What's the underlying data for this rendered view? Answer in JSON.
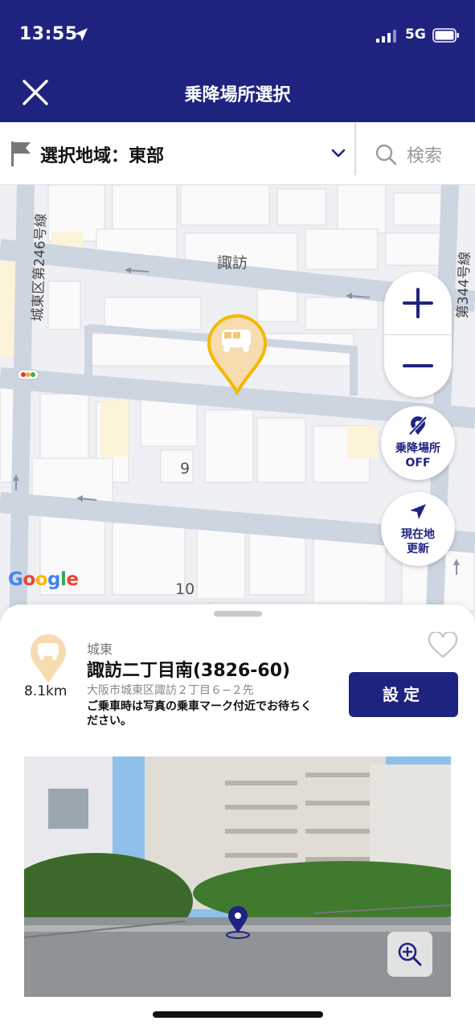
{
  "status_bar": {
    "time": "13:55",
    "network": "5G"
  },
  "header": {
    "title": "乗降場所選択"
  },
  "area_bar": {
    "label": "選択地域：東部",
    "search_label": "検索"
  },
  "map": {
    "labels": {
      "district": "諏訪",
      "road_left": "城東区第246号線",
      "road_right": "第344号線",
      "block_9": "9",
      "block_10": "10"
    },
    "google_logo": "Google",
    "stops_toggle": {
      "line1": "乗降場所",
      "line2": "OFF"
    },
    "refresh_location": {
      "line1": "現在地",
      "line2": "更新"
    }
  },
  "stop": {
    "region": "城東",
    "name": "諏訪二丁目南(3826-60)",
    "address": "大阪市城東区諏訪２丁目６−２先",
    "note": "ご乗車時は写真の乗車マーク付近でお待ちください。",
    "distance": "8.1km",
    "set_label": "設定",
    "favorite": false
  },
  "icons": {
    "close": "close-icon",
    "flag": "flag-icon",
    "search": "search-icon",
    "chevron": "chevron-down-icon",
    "zoom_in": "plus-icon",
    "zoom_out": "minus-icon",
    "stop_marker": "bus-stop-marker-icon",
    "heart": "heart-icon",
    "navigate": "navigation-arrow-icon",
    "photo_zoom": "zoom-in-icon"
  },
  "colors": {
    "brand_navy": "#1f2380",
    "marker_gold": "#f5b800",
    "marker_fill": "#f6dcae"
  }
}
